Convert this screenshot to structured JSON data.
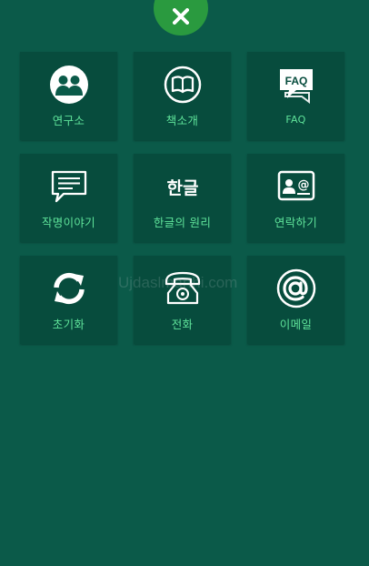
{
  "close_button": {
    "icon": "close-icon"
  },
  "menu": [
    {
      "id": "research",
      "label": "연구소",
      "icon": "people-icon"
    },
    {
      "id": "books",
      "label": "책소개",
      "icon": "book-icon"
    },
    {
      "id": "faq",
      "label": "FAQ",
      "icon": "faq-bubble-icon",
      "icon_text": "FAQ"
    },
    {
      "id": "naming",
      "label": "작명이야기",
      "icon": "message-icon"
    },
    {
      "id": "hangul",
      "label": "한글의 원리",
      "icon": "hangul-icon",
      "icon_text": "한글"
    },
    {
      "id": "contact",
      "label": "연락하기",
      "icon": "contact-card-icon"
    },
    {
      "id": "reset",
      "label": "초기화",
      "icon": "refresh-icon"
    },
    {
      "id": "phone",
      "label": "전화",
      "icon": "telephone-icon"
    },
    {
      "id": "email",
      "label": "이메일",
      "icon": "at-sign-icon"
    }
  ],
  "colors": {
    "background": "#0b5a49",
    "tile": "#074c3d",
    "label": "#5fe39a",
    "close": "#2a9a3f"
  },
  "watermark": "Ujdaslmarthi.com"
}
